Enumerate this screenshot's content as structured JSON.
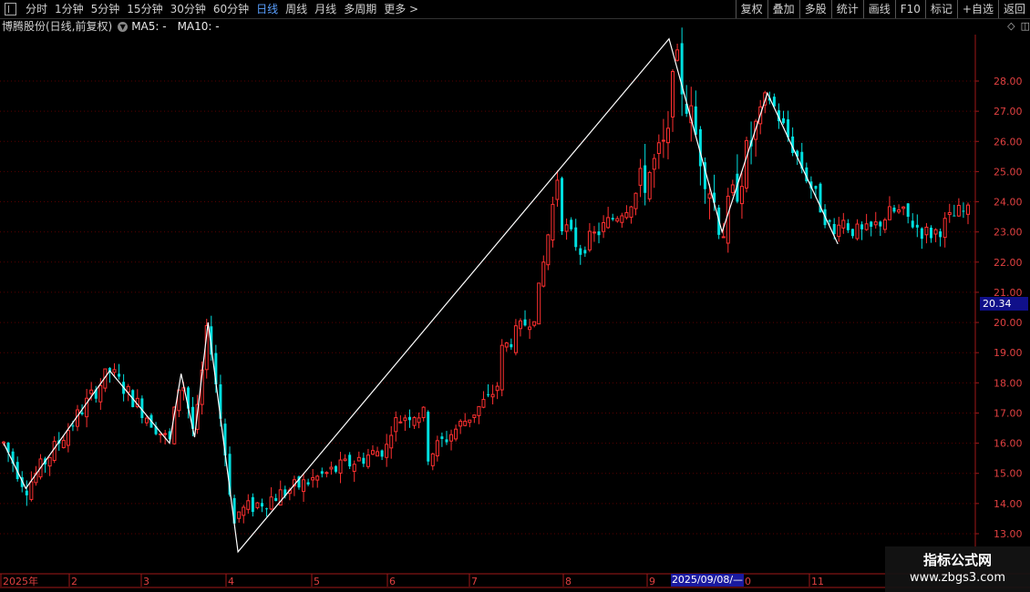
{
  "toolbar": {
    "periods": [
      "分时",
      "1分钟",
      "5分钟",
      "15分钟",
      "30分钟",
      "60分钟",
      "日线",
      "周线",
      "月线",
      "多周期",
      "更多 >"
    ],
    "active_period": "日线",
    "right_buttons": [
      "复权",
      "叠加",
      "多股",
      "统计",
      "画线",
      "F10",
      "标记",
      "+自选",
      "返回"
    ]
  },
  "info": {
    "stock_title": "博腾股份(日线,前复权)",
    "ma5": "MA5: -",
    "ma10": "MA10: -"
  },
  "price_axis": [
    "28.00",
    "27.00",
    "26.00",
    "25.00",
    "24.00",
    "23.00",
    "22.00",
    "21.00",
    "20.00",
    "19.00",
    "18.00",
    "17.00",
    "16.00",
    "15.00",
    "14.00",
    "13.00"
  ],
  "current_price_tag": "20.34",
  "date_axis": [
    "2025年",
    "2",
    "3",
    "4",
    "5",
    "6",
    "7",
    "8",
    "9",
    "0",
    "11"
  ],
  "selected_date": "2025/09/08/—",
  "watermark": {
    "line1": "指标公式网",
    "line2": "www.zbgs3.com"
  },
  "colors": {
    "up": "#ff3030",
    "down": "#00e0e0",
    "grid": "#5a0000",
    "zigzag": "#ffffff"
  },
  "chart_data": {
    "type": "candlestick",
    "ylim": [
      12.5,
      29.5
    ],
    "zigzag_pivots": [
      {
        "t": 0.0,
        "price": 16.0
      },
      {
        "t": 0.023,
        "price": 14.5
      },
      {
        "t": 0.11,
        "price": 18.4
      },
      {
        "t": 0.172,
        "price": 16.0
      },
      {
        "t": 0.184,
        "price": 18.3
      },
      {
        "t": 0.198,
        "price": 16.2
      },
      {
        "t": 0.212,
        "price": 20.0
      },
      {
        "t": 0.243,
        "price": 12.4
      },
      {
        "t": 0.69,
        "price": 29.4
      },
      {
        "t": 0.745,
        "price": 23.0
      },
      {
        "t": 0.792,
        "price": 27.6
      },
      {
        "t": 0.865,
        "price": 22.6
      }
    ]
  }
}
